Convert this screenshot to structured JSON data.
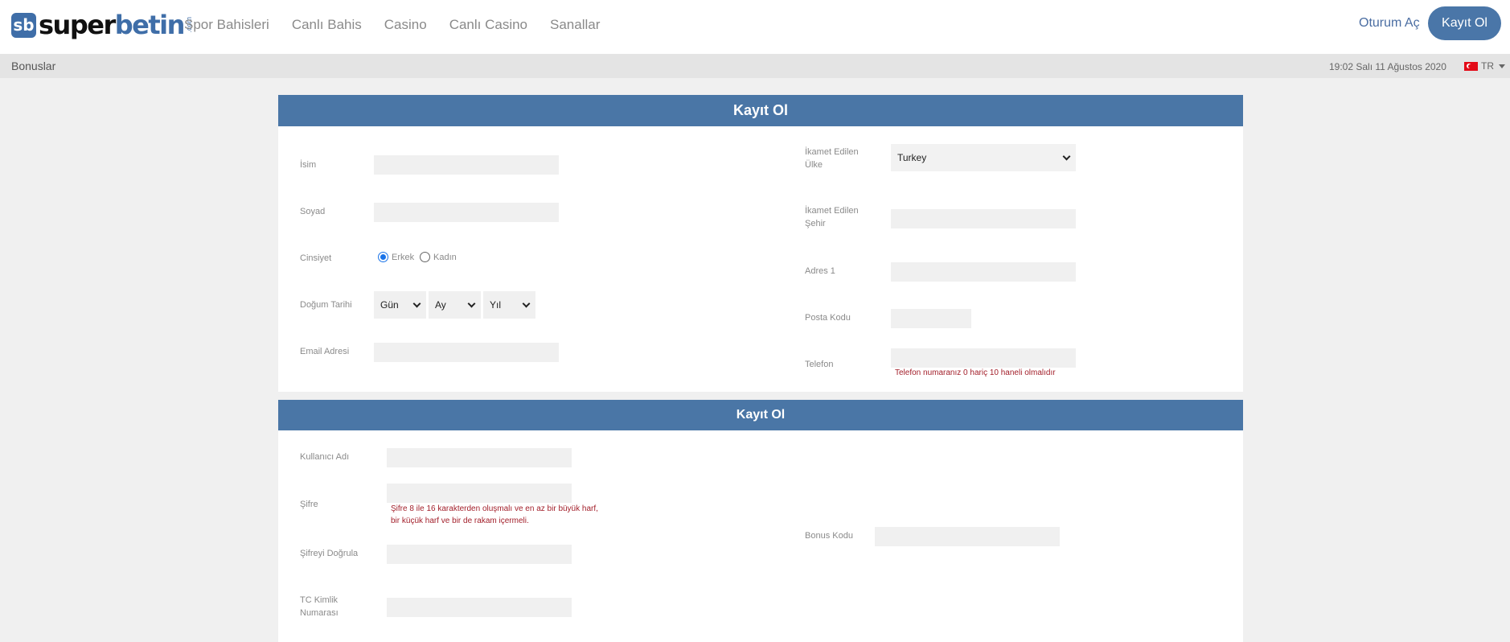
{
  "header": {
    "logo_sb": "sb",
    "logo_a": "super",
    "logo_b": "betin",
    "logo_com": ".com",
    "nav": [
      "Spor Bahisleri",
      "Canlı Bahis",
      "Casino",
      "Canlı Casino",
      "Sanallar"
    ],
    "login_label": "Oturum Aç",
    "register_label": "Kayıt Ol"
  },
  "subbar": {
    "bonus_label": "Bonuslar",
    "datetime": "19:02 Salı 11 Ağustos 2020",
    "lang": "TR"
  },
  "personal": {
    "title": "Kayıt Ol",
    "first_name_label": "İsim",
    "last_name_label": "Soyad",
    "gender_label": "Cinsiyet",
    "gender_male": "Erkek",
    "gender_female": "Kadın",
    "gender_selected": "Erkek",
    "dob_label": "Doğum Tarihi",
    "dob_day": "Gün",
    "dob_month": "Ay",
    "dob_year": "Yıl",
    "email_label": "Email Adresi",
    "country_label_1": "İkamet Edilen",
    "country_label_2": "Ülke",
    "country_value": "Turkey",
    "city_label_1": "İkamet Edilen",
    "city_label_2": "Şehir",
    "address_label": "Adres 1",
    "postal_label": "Posta Kodu",
    "phone_label": "Telefon",
    "phone_hint": "Telefon numaranız 0 hariç 10 haneli olmalıdır"
  },
  "account": {
    "title": "Kayıt Ol",
    "username_label": "Kullanıcı Adı",
    "password_label": "Şifre",
    "password_hint_1": "Şifre 8 ile 16 karakterden oluşmalı ve en az bir büyük harf,",
    "password_hint_2": "bir küçük harf ve bir de rakam içermeli.",
    "password_confirm_label": "Şifreyi Doğrula",
    "tc_label_1": "TC Kimlik",
    "tc_label_2": "Numarası",
    "bonus_code_label": "Bonus Kodu"
  },
  "colors": {
    "brand": "#4a76a6",
    "hint_red": "#a3202b"
  }
}
